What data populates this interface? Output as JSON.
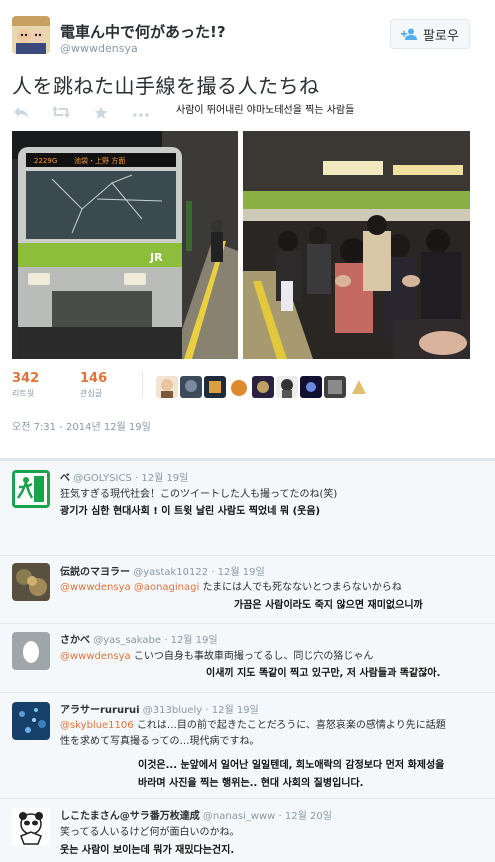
{
  "header": {
    "display_name": "電車ん中で何があった!?",
    "screen_name": "@wwwdensya",
    "follow_label": "팔로우"
  },
  "tweet": {
    "text": "人を跳ねた山手線を撮る人たちね",
    "translation": "사람이 뛰어내린 야마노테선을 찍는 사람들",
    "retweets_count": "342",
    "retweets_label": "리트윗",
    "favorites_count": "146",
    "favorites_label": "관심글",
    "timestamp": "오전 7:31 - 2014년 12월 19일"
  },
  "icons": [
    "reply-icon",
    "retweet-icon",
    "favorite-icon",
    "more-icon",
    "add-user-icon"
  ],
  "replies": [
    {
      "name": "ベ",
      "handle": "@GOLYSICS",
      "date": "· 12월 19일",
      "lines": [
        "狂気すぎる現代社会！このツイートした人も撮ってたのね(笑)"
      ],
      "translation": [
        "광기가 심한 현대사회 ! 이 트윗 날린 사람도 찍었네 뭐 (웃음)"
      ]
    },
    {
      "name": "伝説のマヨラー",
      "handle": "@yastak10122",
      "date": "· 12월 19일",
      "mention1": "@wwwdensya",
      "mention2": "@aonaginagi",
      "body": "たまには人でも死なないとつまらないからね",
      "translation": [
        "가끔은 사람이라도 죽지 않으면 재미없으니까"
      ]
    },
    {
      "name": "さかべ",
      "handle": "@yas_sakabe",
      "date": "· 12월 19일",
      "mention1": "@wwwdensya",
      "body": "こいつ自身も事故車両撮ってるし、同じ穴の狢じゃん",
      "translation": [
        "이새끼 지도 똑같이 찍고 있구만, 저 사람들과 똑같잖아."
      ]
    },
    {
      "name": "アラサーrururui",
      "handle": "@313bluely",
      "date": "· 12월 19일",
      "mention1": "@skyblue1106",
      "body": "これは…目の前で起きたことだろうに、喜怒哀楽の感情より先に話題",
      "line2": "性を求めて写真撮るっての…現代病ですね。",
      "translation": [
        "이것은... 눈앞에서 일어난 일일텐데, 희노애락의 감정보다 먼저 화제성을",
        "바라며 사진을 찍는 행위는.. 현대 사회의 질병입니다."
      ]
    },
    {
      "name": "しこたまさん@サラ番万枚達成",
      "handle": "@nanasi_www",
      "date": "· 12월 20일",
      "body": "笑ってる人いるけど何が面白いのかね。",
      "translation": [
        "웃는 사람이 보이는데 뭐가 재밌다는건지."
      ]
    }
  ]
}
